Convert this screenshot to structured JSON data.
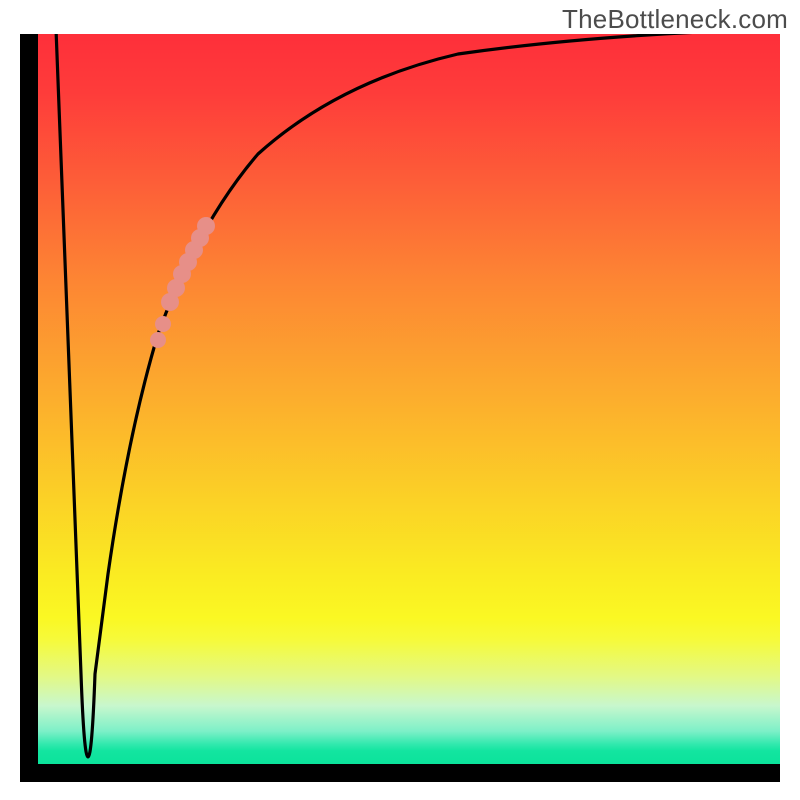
{
  "watermark": "TheBottleneck.com",
  "chart_data": {
    "type": "line",
    "title": "",
    "xlabel": "",
    "ylabel": "",
    "xlim": [
      0,
      100
    ],
    "ylim": [
      0,
      100
    ],
    "background_gradient": {
      "orientation": "vertical",
      "stops": [
        {
          "pos": 0.0,
          "color": "#fe2f3a"
        },
        {
          "pos": 0.5,
          "color": "#fcae2d"
        },
        {
          "pos": 0.8,
          "color": "#faf823"
        },
        {
          "pos": 1.0,
          "color": "#0be39b"
        }
      ]
    },
    "series": [
      {
        "name": "bottleneck-curve",
        "x": [
          2,
          5,
          6,
          7,
          8,
          10,
          14,
          18,
          24,
          32,
          45,
          60,
          80,
          100
        ],
        "y": [
          100,
          12,
          1,
          1,
          12,
          26,
          50,
          62,
          74,
          84,
          92,
          96,
          98.5,
          100
        ],
        "stroke": "#000000"
      }
    ],
    "markers": {
      "name": "highlight-points",
      "color": "#e78f88",
      "points": [
        {
          "x": 16.2,
          "y": 58
        },
        {
          "x": 16.9,
          "y": 55.5
        },
        {
          "x": 18.0,
          "y": 63.0
        },
        {
          "x": 18.8,
          "y": 65.0
        },
        {
          "x": 19.6,
          "y": 67.0
        },
        {
          "x": 20.4,
          "y": 68.5
        },
        {
          "x": 21.2,
          "y": 70.0
        },
        {
          "x": 22.0,
          "y": 72.0
        },
        {
          "x": 22.8,
          "y": 73.5
        }
      ]
    }
  }
}
